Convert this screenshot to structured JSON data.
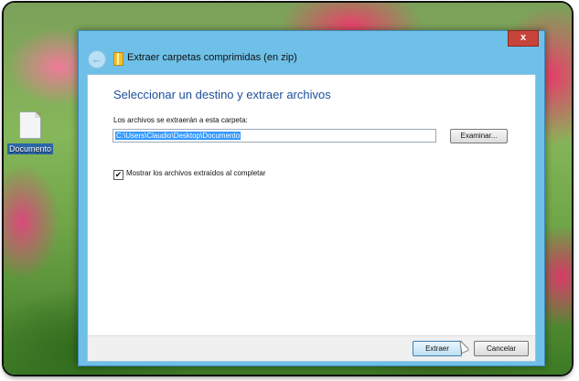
{
  "desktop": {
    "icon_label": "Documento"
  },
  "dialog": {
    "title": "Extraer carpetas comprimidas (en zip)",
    "close_label": "x",
    "heading": "Seleccionar un destino y extraer archivos",
    "folder_label": "Los archivos se extraerán a esta carpeta:",
    "path_value": "C:\\Users\\Claudio\\Desktop\\Documento",
    "browse_label": "Examinar...",
    "checkbox_label": "Mostrar los archivos extraídos al completar",
    "checkbox_checked": true,
    "extract_label": "Extraer",
    "cancel_label": "Cancelar"
  },
  "colors": {
    "title_bar": "#6ec0e8",
    "heading": "#1d4f9c",
    "selection": "#3399ff",
    "close": "#c7443a"
  }
}
